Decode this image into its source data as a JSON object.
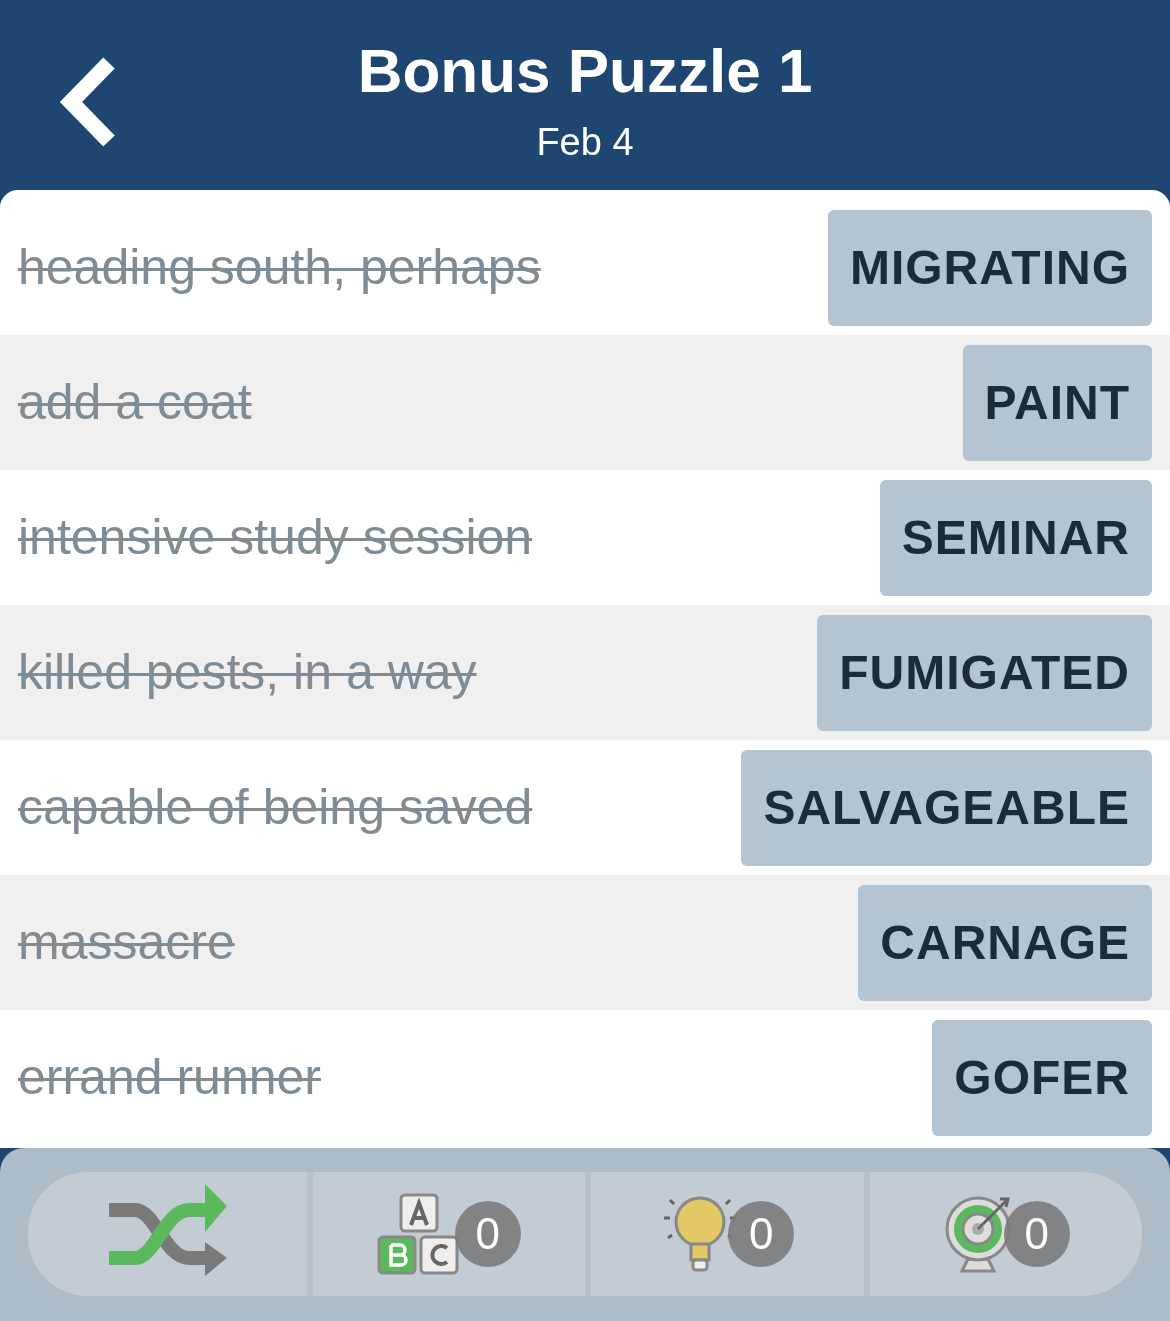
{
  "header": {
    "title": "Bonus Puzzle 1",
    "subtitle": "Feb 4"
  },
  "clues": [
    {
      "clue": "heading south, perhaps",
      "answer": "MIGRATING",
      "solved": true
    },
    {
      "clue": "add a coat",
      "answer": "PAINT",
      "solved": true
    },
    {
      "clue": "intensive study session",
      "answer": "SEMINAR",
      "solved": true
    },
    {
      "clue": "killed pests, in a way",
      "answer": "FUMIGATED",
      "solved": true
    },
    {
      "clue": "capable of being saved",
      "answer": "SALVAGEABLE",
      "solved": true
    },
    {
      "clue": "massacre",
      "answer": "CARNAGE",
      "solved": true
    },
    {
      "clue": "errand runner",
      "answer": "GOFER",
      "solved": true
    }
  ],
  "toolbar": [
    {
      "kind": "shuffle"
    },
    {
      "kind": "letters",
      "count": "0"
    },
    {
      "kind": "hint",
      "count": "0"
    },
    {
      "kind": "target",
      "count": "0"
    }
  ]
}
